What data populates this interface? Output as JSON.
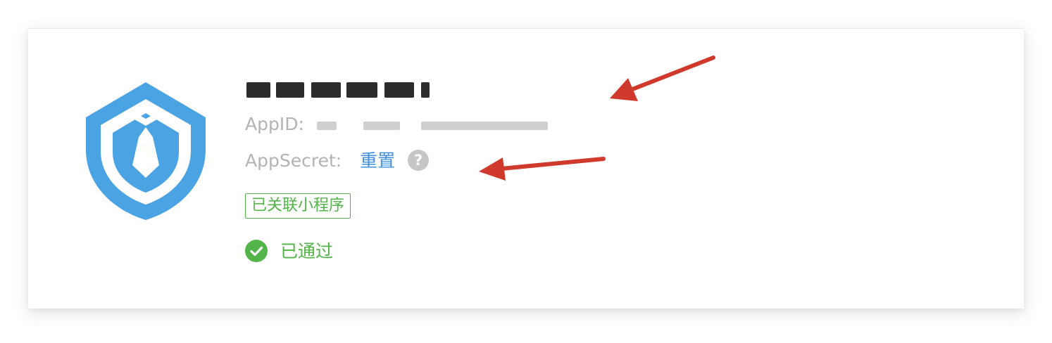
{
  "app": {
    "appid_label": "AppID:",
    "appsecret_label": "AppSecret:",
    "reset_label": "重置",
    "help_symbol": "?",
    "linked_badge": "已关联小程序",
    "status_text": "已通过"
  },
  "colors": {
    "shield": "#4aa3e3",
    "link": "#3f8fe0",
    "success": "#53b449",
    "label": "#b3b3b3",
    "arrow": "#d03a2c"
  },
  "icons": {
    "logo": "shield-tie-icon",
    "help": "question-circle-icon",
    "status": "check-circle-icon"
  }
}
